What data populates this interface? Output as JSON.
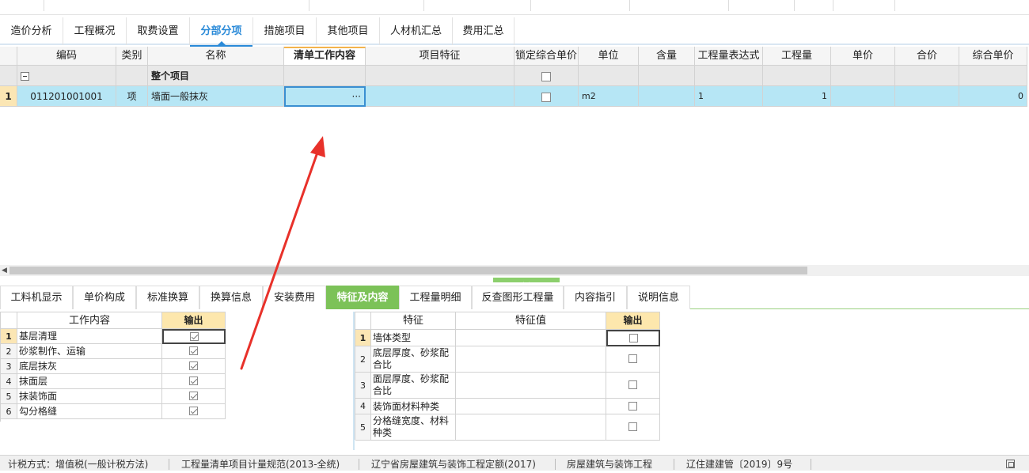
{
  "main_tabs": [
    "造价分析",
    "工程概况",
    "取费设置",
    "分部分项",
    "措施项目",
    "其他项目",
    "人材机汇总",
    "费用汇总"
  ],
  "active_main_tab": "分部分项",
  "grid": {
    "columns": [
      "编码",
      "类别",
      "名称",
      "清单工作内容",
      "项目特征",
      "锁定综合单价",
      "单位",
      "含量",
      "工程量表达式",
      "工程量",
      "单价",
      "合价",
      "综合单价"
    ],
    "group_row": {
      "name": "整个项目"
    },
    "row1": {
      "index": "1",
      "code": "011201001001",
      "type": "项",
      "name": "墙面一般抹灰",
      "content_ellipsis": "···",
      "unit": "m2",
      "expr": "1",
      "qty": "1",
      "total_unit_price": "0"
    }
  },
  "sub_tabs": [
    "工料机显示",
    "单价构成",
    "标准换算",
    "换算信息",
    "安装费用",
    "特征及内容",
    "工程量明细",
    "反查图形工程量",
    "内容指引",
    "说明信息"
  ],
  "active_sub_tab": "特征及内容",
  "work_content": {
    "header_content": "工作内容",
    "header_output": "输出",
    "rows": [
      {
        "no": "1",
        "text": "基层清理",
        "checked": true
      },
      {
        "no": "2",
        "text": "砂浆制作、运输",
        "checked": true
      },
      {
        "no": "3",
        "text": "底层抹灰",
        "checked": true
      },
      {
        "no": "4",
        "text": "抹面层",
        "checked": true
      },
      {
        "no": "5",
        "text": "抹装饰面",
        "checked": true
      },
      {
        "no": "6",
        "text": "勾分格缝",
        "checked": true
      }
    ]
  },
  "features": {
    "header_feature": "特征",
    "header_value": "特征值",
    "header_output": "输出",
    "rows": [
      {
        "no": "1",
        "text": "墙体类型",
        "checked": false
      },
      {
        "no": "2",
        "text": "底层厚度、砂浆配合比",
        "checked": false
      },
      {
        "no": "3",
        "text": "面层厚度、砂浆配合比",
        "checked": false
      },
      {
        "no": "4",
        "text": "装饰面材料种类",
        "checked": false
      },
      {
        "no": "5",
        "text": "分格缝宽度、材料种类",
        "checked": false
      }
    ]
  },
  "status_bar": [
    "计税方式：增值税(一般计税方法)",
    "工程量清单项目计量规范(2013-全统)",
    "辽宁省房屋建筑与装饰工程定额(2017)",
    "房屋建筑与装饰工程",
    "辽住建建管〔2019〕9号"
  ],
  "colors": {
    "accent_blue": "#2a8ad8",
    "selected_row": "#b6e6f5",
    "green_tab": "#7cc258",
    "output_header": "#fde7ad",
    "annotation_arrow": "#e8312a"
  }
}
